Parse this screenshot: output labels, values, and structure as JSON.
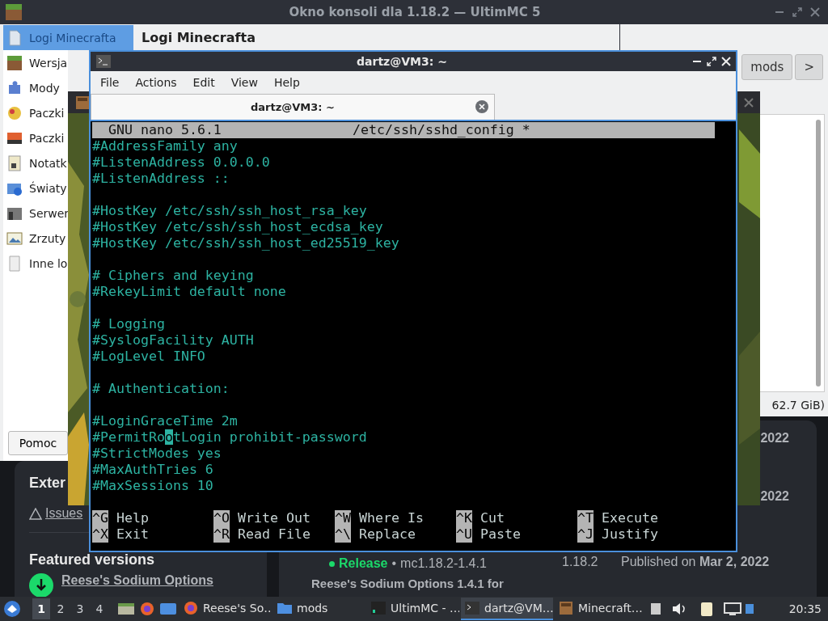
{
  "web_page": {
    "left_panel": {
      "heading": "Exter",
      "issues_link": "Issues",
      "featured_heading": "Featured versions",
      "featured_item": "Reese's Sodium Options"
    },
    "right_panel": {
      "dates": [
        "2022",
        "2022"
      ],
      "version_row": {
        "channel": "Release",
        "separator": "•",
        "version": "mc1.18.2-1.4.1",
        "game_version": "1.18.2",
        "published_prefix": "Published on",
        "published_date": "Mar 2, 2022"
      },
      "next_title": "Reese's Sodium Options 1.4.1 for"
    }
  },
  "console_window": {
    "title": "Okno konsoli dla 1.18.2 — UltimMC 5",
    "sidebar": [
      {
        "label": "Logi Minecrafta",
        "kind": "log",
        "selected": true
      },
      {
        "label": "Wersja",
        "kind": "version",
        "selected": false
      },
      {
        "label": "Mody",
        "kind": "mods",
        "selected": false
      },
      {
        "label": "Paczki",
        "kind": "resourcepacks",
        "selected": false
      },
      {
        "label": "Paczki",
        "kind": "shaderpacks",
        "selected": false
      },
      {
        "label": "Notatk",
        "kind": "notes",
        "selected": false
      },
      {
        "label": "Światy",
        "kind": "worlds",
        "selected": false
      },
      {
        "label": "Serwer",
        "kind": "servers",
        "selected": false
      },
      {
        "label": "Zrzuty",
        "kind": "screenshots",
        "selected": false
      },
      {
        "label": "Inne lo",
        "kind": "other",
        "selected": false
      }
    ],
    "page_title": "Logi Minecrafta",
    "help_button": "Pomoc"
  },
  "file_window": {
    "path_button": "mods",
    "forward_button": ">",
    "free_space": "62.7 GiB)"
  },
  "terminal": {
    "title": "dartz@VM3: ~",
    "menu": [
      "File",
      "Actions",
      "Edit",
      "View",
      "Help"
    ],
    "tab": "dartz@VM3: ~",
    "nano": {
      "app": "GNU nano 5.6.1",
      "file": "/etc/ssh/sshd_config *",
      "lines": [
        {
          "kind": "text",
          "text": "#AddressFamily any"
        },
        {
          "kind": "text",
          "text": "#ListenAddress 0.0.0.0"
        },
        {
          "kind": "text",
          "text": "#ListenAddress ::"
        },
        {
          "kind": "blank"
        },
        {
          "kind": "text",
          "text": "#HostKey /etc/ssh/ssh_host_rsa_key"
        },
        {
          "kind": "text",
          "text": "#HostKey /etc/ssh/ssh_host_ecdsa_key"
        },
        {
          "kind": "text",
          "text": "#HostKey /etc/ssh/ssh_host_ed25519_key"
        },
        {
          "kind": "blank"
        },
        {
          "kind": "text",
          "text": "# Ciphers and keying"
        },
        {
          "kind": "text",
          "text": "#RekeyLimit default none"
        },
        {
          "kind": "blank"
        },
        {
          "kind": "text",
          "text": "# Logging"
        },
        {
          "kind": "text",
          "text": "#SyslogFacility AUTH"
        },
        {
          "kind": "text",
          "text": "#LogLevel INFO"
        },
        {
          "kind": "blank"
        },
        {
          "kind": "text",
          "text": "# Authentication:"
        },
        {
          "kind": "blank"
        },
        {
          "kind": "text",
          "text": "#LoginGraceTime 2m"
        },
        {
          "kind": "cursor",
          "before": "#PermitRo",
          "cursor": "o",
          "after": "tLogin prohibit-password"
        },
        {
          "kind": "text",
          "text": "#StrictModes yes"
        },
        {
          "kind": "text",
          "text": "#MaxAuthTries 6"
        },
        {
          "kind": "text",
          "text": "#MaxSessions 10"
        },
        {
          "kind": "blank"
        }
      ],
      "shortcuts": [
        {
          "key": "^G",
          "label": "Help"
        },
        {
          "key": "^O",
          "label": "Write Out"
        },
        {
          "key": "^W",
          "label": "Where Is"
        },
        {
          "key": "^K",
          "label": "Cut"
        },
        {
          "key": "^T",
          "label": "Execute"
        },
        {
          "key": "^X",
          "label": "Exit"
        },
        {
          "key": "^R",
          "label": "Read File"
        },
        {
          "key": "^\\",
          "label": "Replace"
        },
        {
          "key": "^U",
          "label": "Paste"
        },
        {
          "key": "^J",
          "label": "Justify"
        }
      ]
    }
  },
  "taskbar": {
    "desktops": [
      {
        "label": "1",
        "selected": true
      },
      {
        "label": "2",
        "selected": false
      },
      {
        "label": "3",
        "selected": false
      },
      {
        "label": "4",
        "selected": false
      }
    ],
    "tasks": [
      {
        "label": "Reese's So…",
        "kind": "browser",
        "selected": false
      },
      {
        "label": "mods",
        "kind": "folder",
        "selected": false
      },
      {
        "label": "UltimMC - …",
        "kind": "launcher",
        "selected": false
      },
      {
        "label": "dartz@VM…",
        "kind": "terminal",
        "selected": true
      },
      {
        "label": "Minecraft…",
        "kind": "game",
        "selected": false
      }
    ],
    "clock": "20:35"
  }
}
